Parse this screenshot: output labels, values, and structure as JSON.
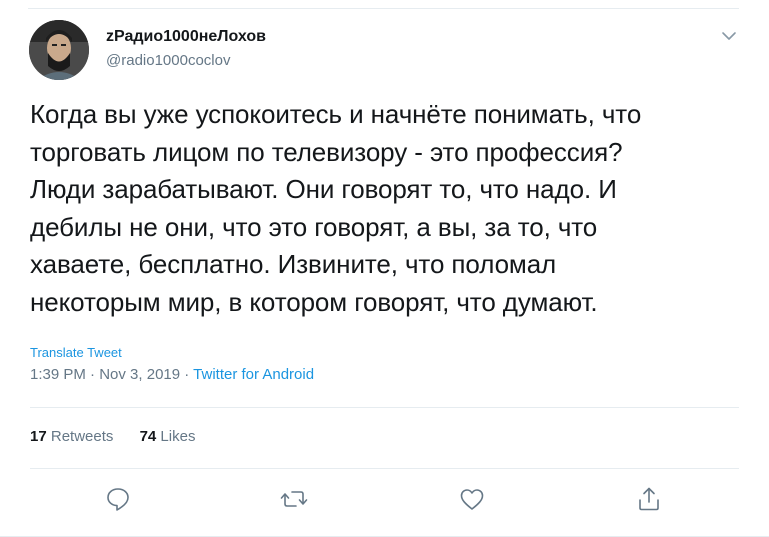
{
  "author": {
    "name": "zРадио1000неЛохов",
    "handle": "@radio1000coclov"
  },
  "tweet": {
    "text": "Когда вы уже успокоитесь и начнёте понимать, что\nторговать лицом по телевизору - это профессия?\nЛюди зарабатывают. Они говорят то, что надо. И\nдебилы не они, что это говорят, а вы, за то, что\nхаваете, бесплатно. Извините, что поломал\nнекоторым мир, в котором говорят, что думают.",
    "translate_label": "Translate Tweet",
    "time": "1:39 PM",
    "sep1": " · ",
    "date": "Nov 3, 2019",
    "sep2": " · ",
    "source": "Twitter for Android"
  },
  "stats": {
    "retweets_count": "17",
    "retweets_label": "Retweets",
    "likes_count": "74",
    "likes_label": "Likes"
  },
  "icons": {
    "caret": "chevron-down-icon",
    "reply": "reply-icon",
    "retweet": "retweet-icon",
    "like": "heart-icon",
    "share": "share-icon"
  },
  "colors": {
    "text": "#14171a",
    "secondary": "#657786",
    "link": "#1b95e0",
    "divider": "#e6ecf0"
  }
}
